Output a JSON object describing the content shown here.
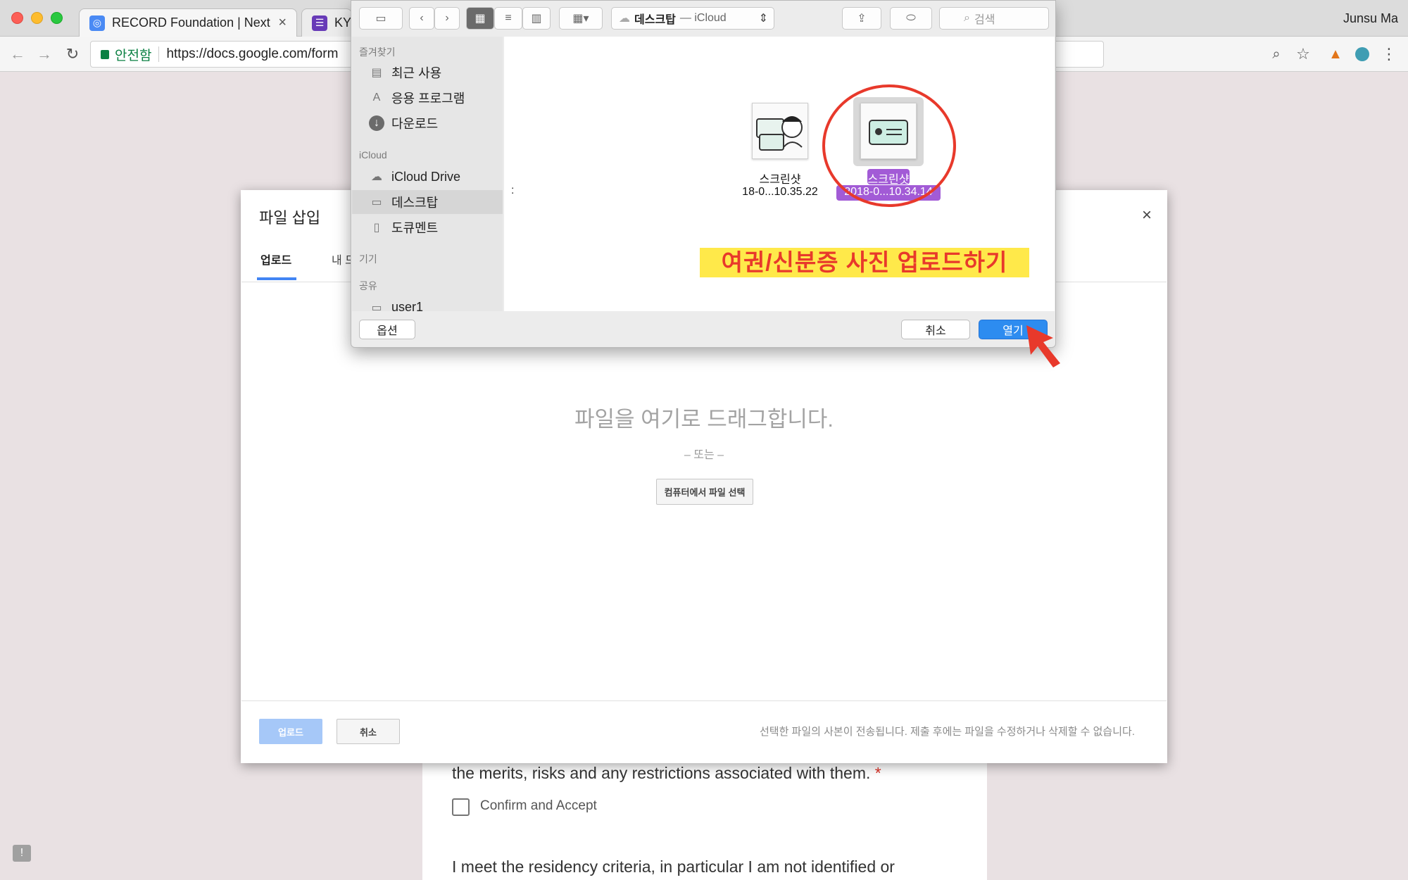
{
  "browser": {
    "tabs": [
      {
        "title": "RECORD Foundation | Next ge",
        "close": "×"
      },
      {
        "title": "KYC"
      }
    ],
    "profile_name": "Junsu Ma",
    "secure_label": "안전함",
    "url": "https://docs.google.com/form"
  },
  "form": {
    "question1_tail": "the merits, risks and any restrictions associated with them.",
    "required_mark": "*",
    "checkbox_label": "Confirm and Accept",
    "question2": "I meet the residency criteria, in particular I am not identified or"
  },
  "insert_dialog": {
    "title": "파일 삽입",
    "tabs": [
      "업로드",
      "내 드"
    ],
    "close": "×",
    "drag_text": "파일을 여기로 드래그합니다.",
    "or_text": "– 또는 –",
    "choose_button": "컴퓨터에서 파일 선택",
    "upload_button": "업로드",
    "cancel_button": "취소",
    "footer_note": "선택한 파일의 사본이 전송됩니다. 제출 후에는 파일을 수정하거나 삭제할 수 없습니다."
  },
  "finder": {
    "location": "데스크탑",
    "location_suffix": "— iCloud",
    "search_placeholder": "검색",
    "sidebar": {
      "favorites_header": "즐겨찾기",
      "favorites": [
        "최근 사용",
        "응용 프로그램",
        "다운로드"
      ],
      "icloud_header": "iCloud",
      "icloud_items": [
        "iCloud Drive",
        "데스크탑",
        "도큐멘트"
      ],
      "devices_header": "기기",
      "shared_header": "공유",
      "shared_items": [
        "user1"
      ]
    },
    "files": [
      {
        "name_line1": "스크린샷",
        "name_line2": "18-0...10.35.22"
      },
      {
        "name_line1": "스크린샷",
        "name_line2": "2018-0...10.34.14"
      }
    ],
    "stray_char": ":",
    "annotation": "여권/신분증 사진 업로드하기",
    "options_button": "옵션",
    "cancel_button": "취소",
    "open_button": "열기"
  },
  "colors": {
    "accent_blue": "#1a73e8",
    "annotation_red": "#e8392b",
    "annotation_highlight": "#ffe94a",
    "selection_purple": "#a25bd6",
    "mac_blue": "#2d8cf0"
  }
}
